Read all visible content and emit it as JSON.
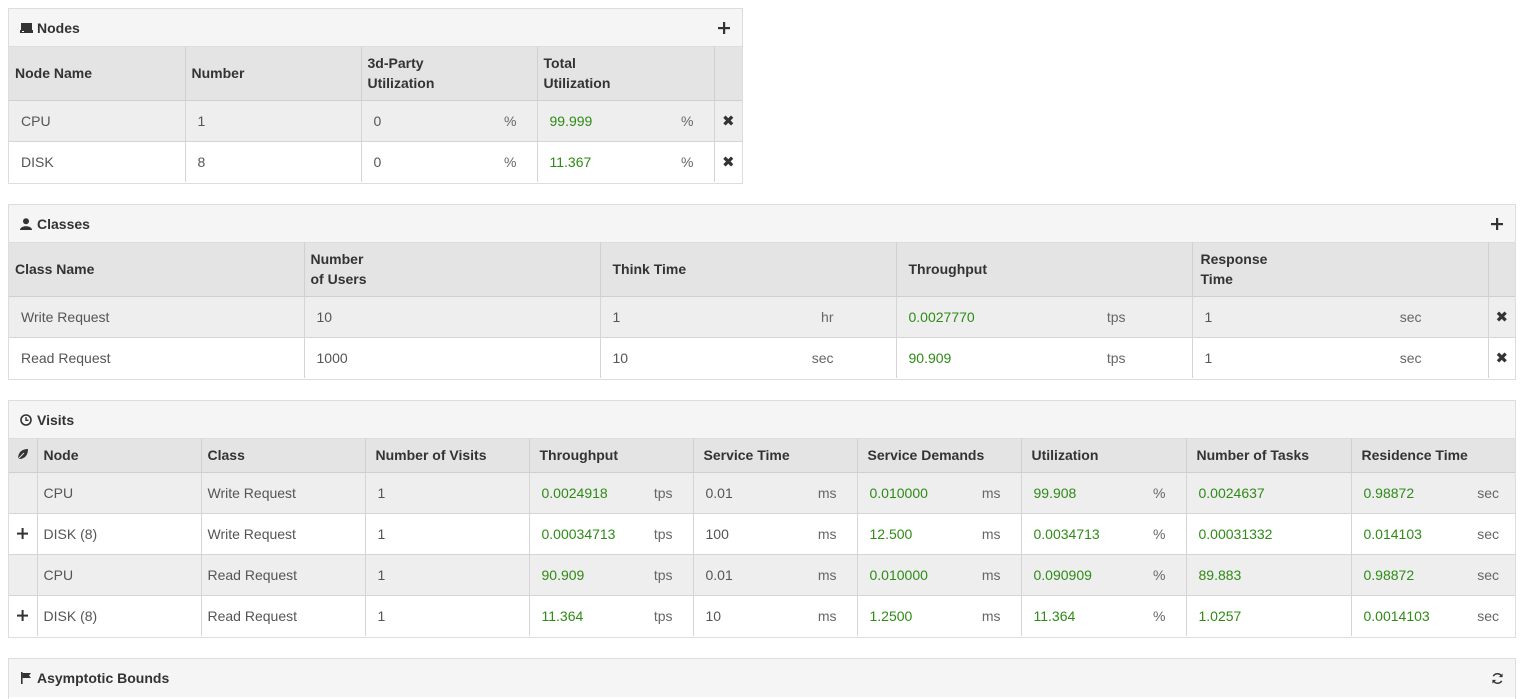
{
  "nodes": {
    "title": "Nodes",
    "headers": [
      "Node Name",
      "Number",
      "3d-Party Utilization",
      "Total Utilization"
    ],
    "headers_split": [
      [
        "Node Name"
      ],
      [
        "Number"
      ],
      [
        "3d-Party",
        "Utilization"
      ],
      [
        "Total",
        "Utilization"
      ]
    ],
    "rows": [
      {
        "name": "CPU",
        "number": "1",
        "third_party": "0",
        "third_unit": "%",
        "total": "99.999",
        "total_unit": "%"
      },
      {
        "name": "DISK",
        "number": "8",
        "third_party": "0",
        "third_unit": "%",
        "total": "11.367",
        "total_unit": "%"
      }
    ]
  },
  "classes": {
    "title": "Classes",
    "headers_split": [
      [
        "Class Name"
      ],
      [
        "Number",
        "of Users"
      ],
      [
        "Think Time"
      ],
      [
        "Throughput"
      ],
      [
        "Response",
        "Time"
      ]
    ],
    "rows": [
      {
        "name": "Write Request",
        "users": "10",
        "think": "1",
        "think_unit": "hr",
        "throughput": "0.0027770",
        "tp_unit": "tps",
        "response": "1",
        "resp_unit": "sec"
      },
      {
        "name": "Read Request",
        "users": "1000",
        "think": "10",
        "think_unit": "sec",
        "throughput": "90.909",
        "tp_unit": "tps",
        "response": "1",
        "resp_unit": "sec"
      }
    ]
  },
  "visits": {
    "title": "Visits",
    "headers": [
      "Node",
      "Class",
      "Number of Visits",
      "Throughput",
      "Service Time",
      "Service Demands",
      "Utilization",
      "Number of Tasks",
      "Residence Time"
    ],
    "rows": [
      {
        "expand": false,
        "node": "CPU",
        "class": "Write Request",
        "visits": "1",
        "throughput": "0.0024918",
        "tp_unit": "tps",
        "service_time": "0.01",
        "st_unit": "ms",
        "demands": "0.010000",
        "d_unit": "ms",
        "util": "99.908",
        "u_unit": "%",
        "tasks": "0.0024637",
        "residence": "0.98872",
        "r_unit": "sec"
      },
      {
        "expand": true,
        "node": "DISK (8)",
        "class": "Write Request",
        "visits": "1",
        "throughput": "0.00034713",
        "tp_unit": "tps",
        "service_time": "100",
        "st_unit": "ms",
        "demands": "12.500",
        "d_unit": "ms",
        "util": "0.0034713",
        "u_unit": "%",
        "tasks": "0.00031332",
        "residence": "0.014103",
        "r_unit": "sec"
      },
      {
        "expand": false,
        "node": "CPU",
        "class": "Read Request",
        "visits": "1",
        "throughput": "90.909",
        "tp_unit": "tps",
        "service_time": "0.01",
        "st_unit": "ms",
        "demands": "0.010000",
        "d_unit": "ms",
        "util": "0.090909",
        "u_unit": "%",
        "tasks": "89.883",
        "residence": "0.98872",
        "r_unit": "sec"
      },
      {
        "expand": true,
        "node": "DISK (8)",
        "class": "Read Request",
        "visits": "1",
        "throughput": "11.364",
        "tp_unit": "tps",
        "service_time": "10",
        "st_unit": "ms",
        "demands": "1.2500",
        "d_unit": "ms",
        "util": "11.364",
        "u_unit": "%",
        "tasks": "1.0257",
        "residence": "0.0014103",
        "r_unit": "sec"
      }
    ]
  },
  "bounds": {
    "title": "Asymptotic Bounds"
  },
  "icons": {
    "nodes": "server-icon",
    "classes": "user-icon",
    "visits": "clock-icon",
    "bounds": "flag-icon",
    "add": "plus-icon",
    "remove": "close-icon",
    "refresh": "refresh-icon",
    "leaf": "leaf-icon"
  },
  "colors": {
    "computed_value": "#2e8b16",
    "header_bg": "#e4e4e4",
    "panel_head_bg": "#f5f5f5"
  }
}
